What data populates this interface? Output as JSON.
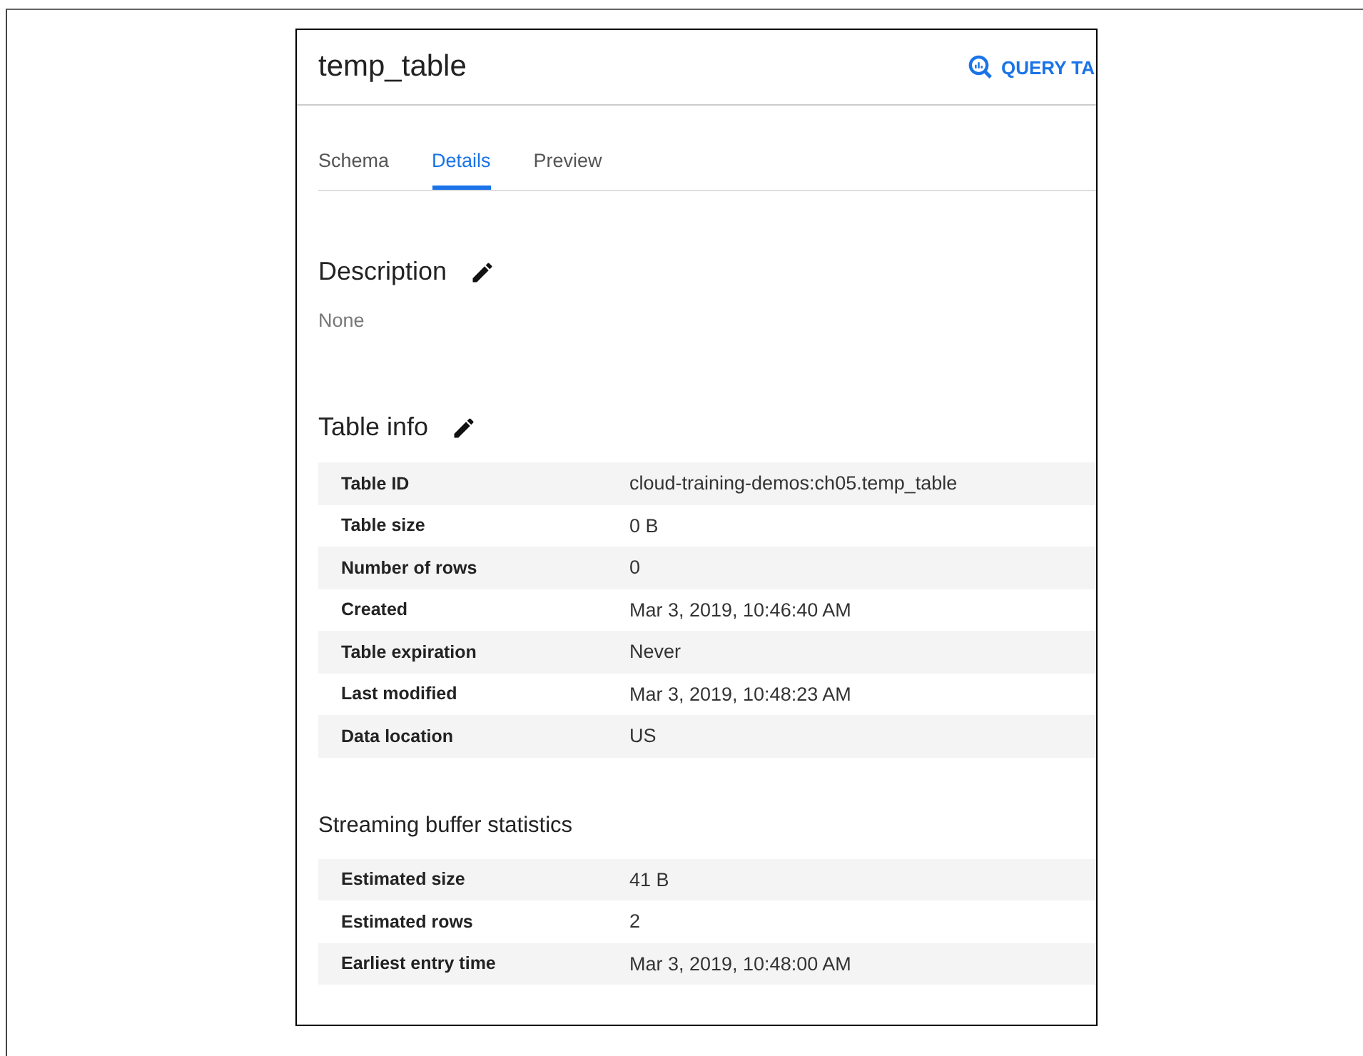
{
  "title": "temp_table",
  "query_button": {
    "label": "QUERY TA"
  },
  "tabs": [
    {
      "label": "Schema",
      "selected": false
    },
    {
      "label": "Details",
      "selected": true
    },
    {
      "label": "Preview",
      "selected": false
    }
  ],
  "description": {
    "heading": "Description",
    "value": "None"
  },
  "table_info": {
    "heading": "Table info",
    "rows": [
      {
        "label": "Table ID",
        "value": "cloud-training-demos:ch05.temp_table"
      },
      {
        "label": "Table size",
        "value": "0 B"
      },
      {
        "label": "Number of rows",
        "value": "0"
      },
      {
        "label": "Created",
        "value": "Mar 3, 2019, 10:46:40 AM"
      },
      {
        "label": "Table expiration",
        "value": "Never"
      },
      {
        "label": "Last modified",
        "value": "Mar 3, 2019, 10:48:23 AM"
      },
      {
        "label": "Data location",
        "value": "US"
      }
    ]
  },
  "streaming": {
    "heading": "Streaming buffer statistics",
    "rows": [
      {
        "label": "Estimated size",
        "value": "41 B"
      },
      {
        "label": "Estimated rows",
        "value": "2"
      },
      {
        "label": "Earliest entry time",
        "value": "Mar 3, 2019, 10:48:00 AM"
      }
    ]
  }
}
